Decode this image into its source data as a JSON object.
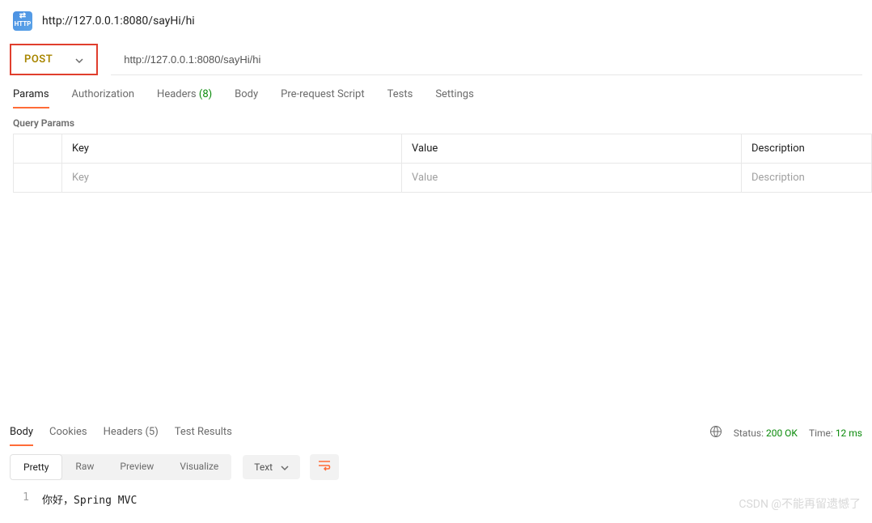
{
  "header": {
    "icon_label": "HTTP",
    "title": "http://127.0.0.1:8080/sayHi/hi"
  },
  "request": {
    "method": "POST",
    "url": "http://127.0.0.1:8080/sayHi/hi"
  },
  "tabs": {
    "params": "Params",
    "authorization": "Authorization",
    "headers": "Headers",
    "headers_count": "(8)",
    "body": "Body",
    "prerequest": "Pre-request Script",
    "tests": "Tests",
    "settings": "Settings"
  },
  "params_section": {
    "title": "Query Params",
    "headers": {
      "key": "Key",
      "value": "Value",
      "description": "Description"
    },
    "placeholders": {
      "key": "Key",
      "value": "Value",
      "description": "Description"
    }
  },
  "response": {
    "tabs": {
      "body": "Body",
      "cookies": "Cookies",
      "headers": "Headers",
      "headers_count": "(5)",
      "test_results": "Test Results"
    },
    "meta": {
      "status_label": "Status:",
      "status_value": "200 OK",
      "time_label": "Time:",
      "time_value": "12 ms"
    },
    "views": {
      "pretty": "Pretty",
      "raw": "Raw",
      "preview": "Preview",
      "visualize": "Visualize"
    },
    "format": "Text",
    "body_lines": [
      {
        "num": "1",
        "text": "你好，Spring MVC"
      }
    ]
  },
  "watermark": "CSDN @不能再留遗憾了"
}
